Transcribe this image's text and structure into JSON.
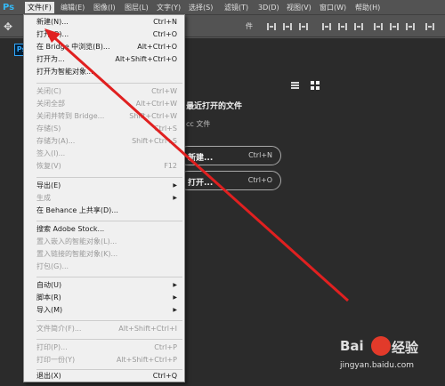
{
  "app": {
    "logo": "Ps",
    "doc_badge": "Ps"
  },
  "menubar": [
    "文件(F)",
    "编辑(E)",
    "图像(I)",
    "图层(L)",
    "文字(Y)",
    "选择(S)",
    "滤镜(T)",
    "3D(D)",
    "视图(V)",
    "窗口(W)",
    "帮助(H)"
  ],
  "options": {
    "partial_text": "件"
  },
  "start": {
    "recent_title": "最近打开的文件",
    "recent_sub": "cc 文件",
    "new_label": "新建...",
    "new_shortcut": "Ctrl+N",
    "open_label": "打开...",
    "open_shortcut": "Ctrl+O"
  },
  "file_menu": [
    {
      "label": "新建(N)...",
      "shortcut": "Ctrl+N",
      "enabled": true
    },
    {
      "label": "打开(O)...",
      "shortcut": "Ctrl+O",
      "enabled": true
    },
    {
      "label": "在 Bridge 中浏览(B)...",
      "shortcut": "Alt+Ctrl+O",
      "enabled": true
    },
    {
      "label": "打开为...",
      "shortcut": "Alt+Shift+Ctrl+O",
      "enabled": true
    },
    {
      "label": "打开为智能对象...",
      "shortcut": "",
      "enabled": true
    },
    {
      "label": "关闭(C)",
      "shortcut": "Ctrl+W",
      "enabled": false
    },
    {
      "label": "关闭全部",
      "shortcut": "Alt+Ctrl+W",
      "enabled": false
    },
    {
      "label": "关闭并转到 Bridge...",
      "shortcut": "Shift+Ctrl+W",
      "enabled": false
    },
    {
      "label": "存储(S)",
      "shortcut": "Ctrl+S",
      "enabled": false
    },
    {
      "label": "存储为(A)...",
      "shortcut": "Shift+Ctrl+S",
      "enabled": false
    },
    {
      "label": "签入(I)...",
      "shortcut": "",
      "enabled": false
    },
    {
      "label": "恢复(V)",
      "shortcut": "F12",
      "enabled": false
    },
    {
      "label": "导出(E)",
      "shortcut": "",
      "enabled": true,
      "submenu": true
    },
    {
      "label": "生成",
      "shortcut": "",
      "enabled": false,
      "submenu": true
    },
    {
      "label": "在 Behance 上共享(D)...",
      "shortcut": "",
      "enabled": true
    },
    {
      "label": "搜索 Adobe Stock...",
      "shortcut": "",
      "enabled": true
    },
    {
      "label": "置入嵌入的智能对象(L)...",
      "shortcut": "",
      "enabled": false
    },
    {
      "label": "置入链接的智能对象(K)...",
      "shortcut": "",
      "enabled": false
    },
    {
      "label": "打包(G)...",
      "shortcut": "",
      "enabled": false
    },
    {
      "label": "自动(U)",
      "shortcut": "",
      "enabled": true,
      "submenu": true
    },
    {
      "label": "脚本(R)",
      "shortcut": "",
      "enabled": true,
      "submenu": true
    },
    {
      "label": "导入(M)",
      "shortcut": "",
      "enabled": true,
      "submenu": true
    },
    {
      "label": "文件简介(F)...",
      "shortcut": "Alt+Shift+Ctrl+I",
      "enabled": false
    },
    {
      "label": "打印(P)...",
      "shortcut": "Ctrl+P",
      "enabled": false
    },
    {
      "label": "打印一份(Y)",
      "shortcut": "Alt+Shift+Ctrl+P",
      "enabled": false
    },
    {
      "label": "退出(X)",
      "shortcut": "Ctrl+Q",
      "enabled": true
    }
  ],
  "watermark": {
    "brand_left": "Bai",
    "brand_right": "经验",
    "url": "jingyan.baidu.com"
  },
  "colors": {
    "annotation": "#e02020",
    "accent": "#31a8ff"
  }
}
